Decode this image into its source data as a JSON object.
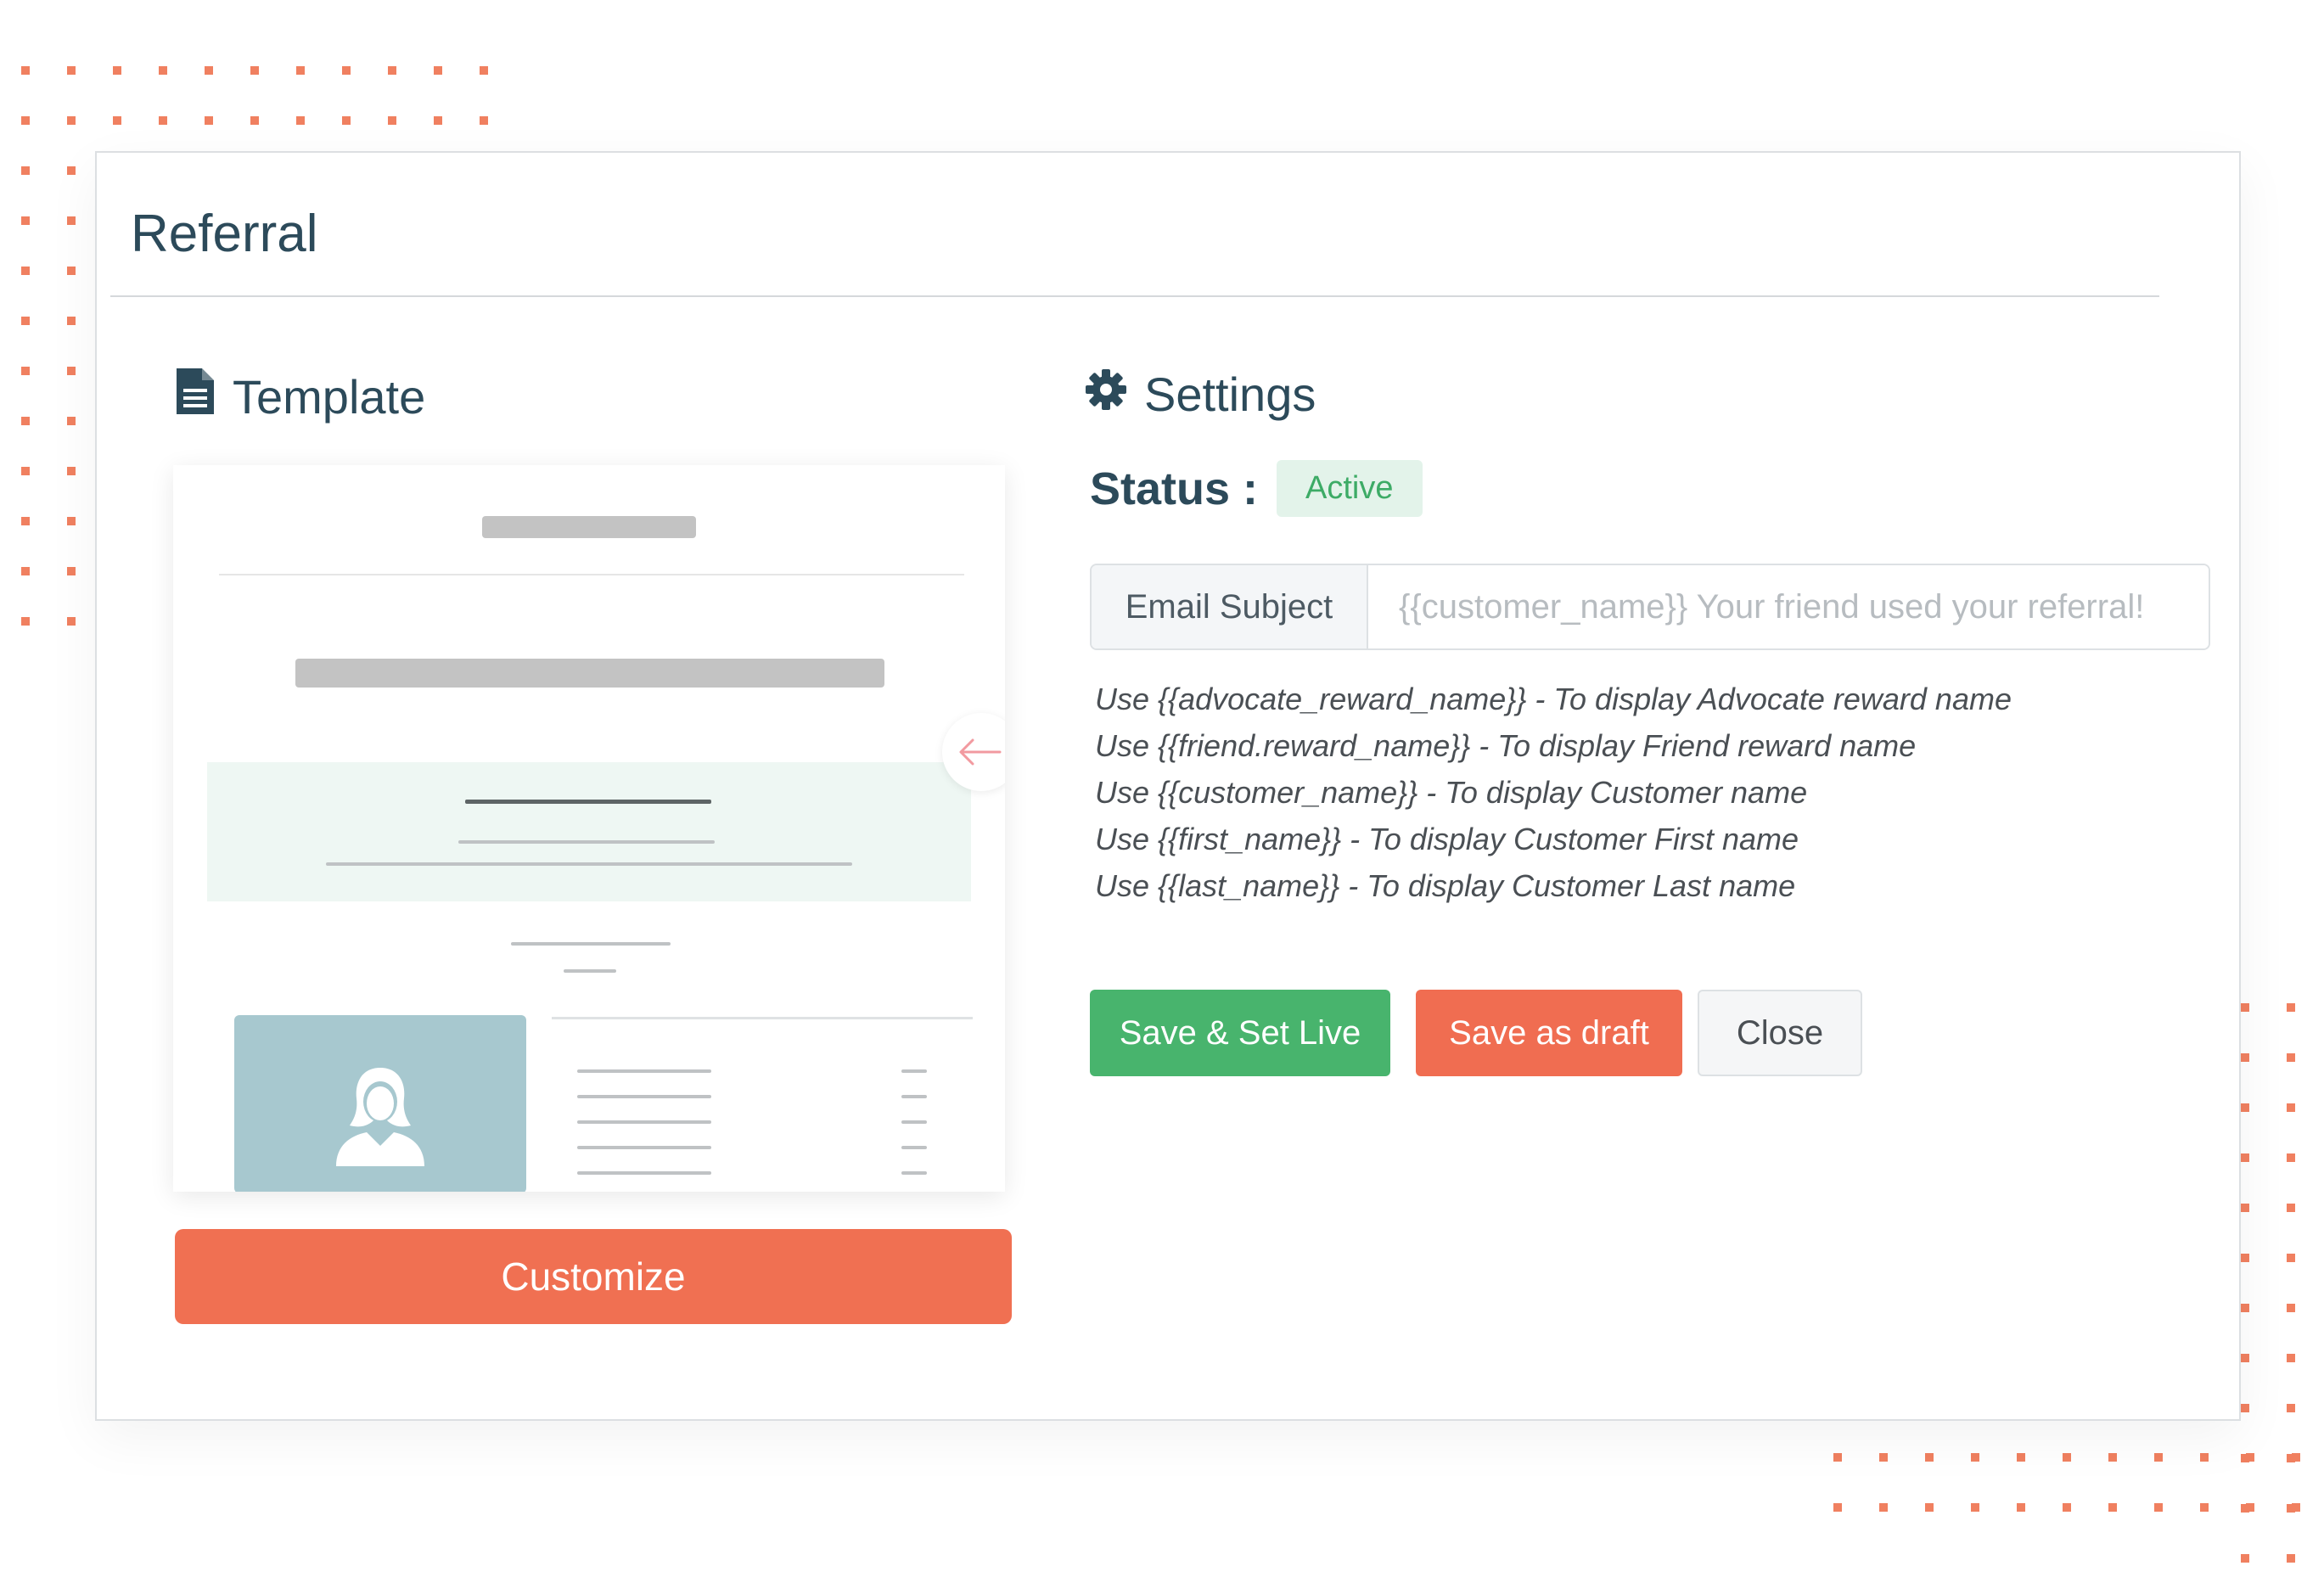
{
  "colors": {
    "accent_orange": "#f07052",
    "success_green": "#48b46d",
    "title_navy": "#2c4a5a",
    "badge_bg": "#e3f3ea",
    "dot_orange": "#f08060"
  },
  "card": {
    "title": "Referral"
  },
  "template_section": {
    "icon": "file-text-icon",
    "heading": "Template",
    "customize_label": "Customize"
  },
  "settings_section": {
    "icon": "gear-icon",
    "heading": "Settings",
    "status_label": "Status :",
    "status_value": "Active",
    "email_subject_label": "Email Subject",
    "email_subject_placeholder": "{{customer_name}} Your friend used your referral!",
    "hints": [
      "Use {{advocate_reward_name}} - To display Advocate reward name",
      "Use {{friend.reward_name}} - To display Friend reward name",
      "Use {{customer_name}} - To display Customer name",
      "Use {{first_name}} -  To display Customer First name",
      "Use {{last_name}} -  To display Customer Last name"
    ],
    "buttons": {
      "save_live": "Save & Set Live",
      "save_draft": "Save as draft",
      "close": "Close"
    }
  }
}
